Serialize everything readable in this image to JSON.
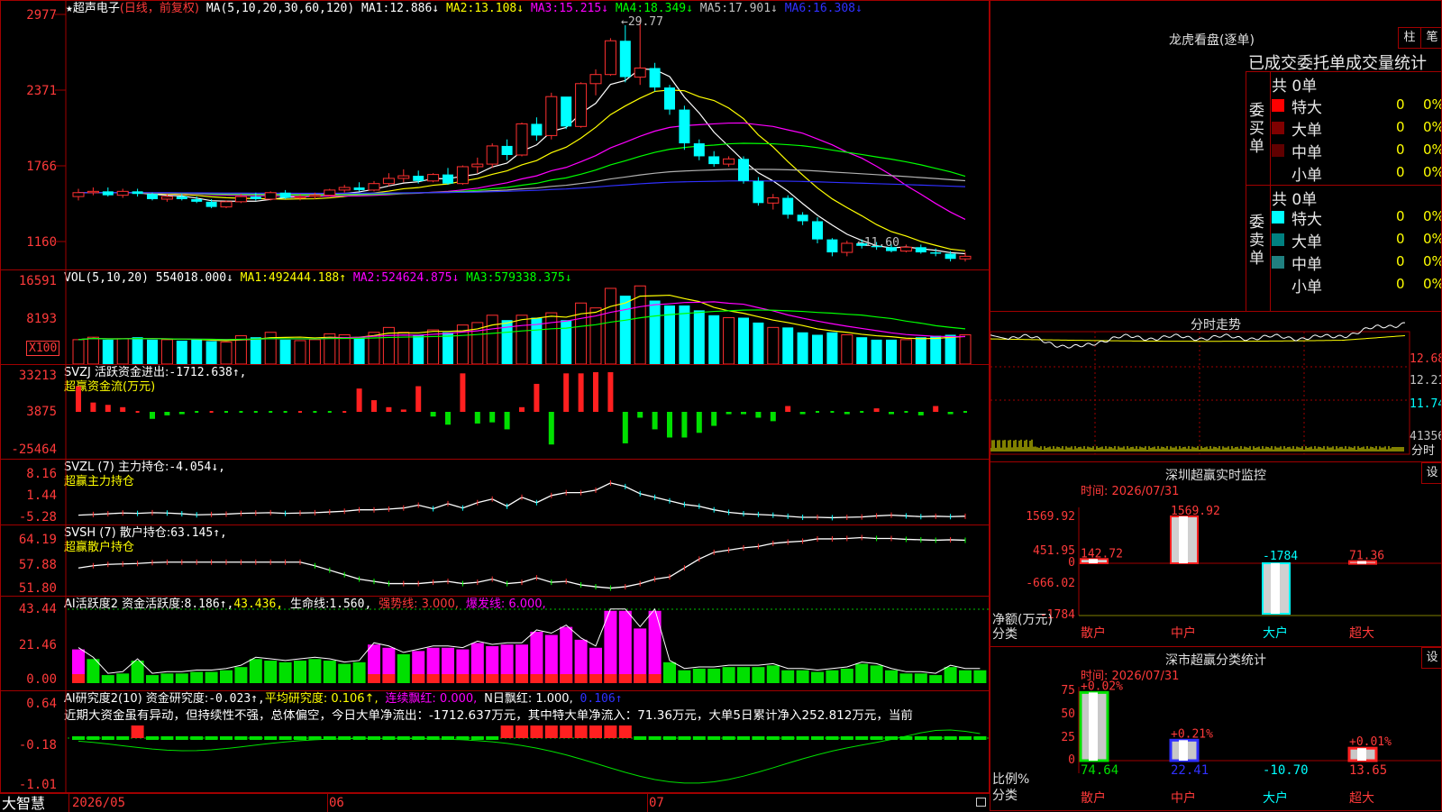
{
  "main": {
    "star": "★",
    "stock_name": "超声电子",
    "mode": "(日线，前复权)",
    "ma_label": "MA(5,10,20,30,60,120)",
    "ma_values": [
      {
        "label": "MA1:",
        "value": "12.886↓",
        "color": "#ffffff"
      },
      {
        "label": "MA2:",
        "value": "13.108↓",
        "color": "#ffff00"
      },
      {
        "label": "MA3:",
        "value": "15.215↓",
        "color": "#ff00ff"
      },
      {
        "label": "MA4:",
        "value": "18.349↓",
        "color": "#00ff00"
      },
      {
        "label": "MA5:",
        "value": "17.901↓",
        "color": "#c0c0c0"
      },
      {
        "label": "MA6:",
        "value": "16.308↓",
        "color": "#3030ff"
      }
    ],
    "y_labels": [
      "2977",
      "2371",
      "1766",
      "1160"
    ],
    "high_label": "←29.77",
    "low_label": "←11.60",
    "candles": [
      [
        16.2,
        16.8,
        15.9,
        16.5
      ],
      [
        16.5,
        16.9,
        16.3,
        16.6
      ],
      [
        16.6,
        16.9,
        16.2,
        16.3
      ],
      [
        16.3,
        16.8,
        16.1,
        16.6
      ],
      [
        16.6,
        16.8,
        16.2,
        16.4
      ],
      [
        16.4,
        16.5,
        15.9,
        16.0
      ],
      [
        16.0,
        16.4,
        15.8,
        16.2
      ],
      [
        16.2,
        16.4,
        15.9,
        16.0
      ],
      [
        16.0,
        16.2,
        15.7,
        15.8
      ],
      [
        15.8,
        16.0,
        15.3,
        15.4
      ],
      [
        15.4,
        15.9,
        15.3,
        15.8
      ],
      [
        15.8,
        16.4,
        15.7,
        16.2
      ],
      [
        16.2,
        16.5,
        15.9,
        16.0
      ],
      [
        16.0,
        16.6,
        15.9,
        16.5
      ],
      [
        16.5,
        16.7,
        16.0,
        16.1
      ],
      [
        16.1,
        16.4,
        15.9,
        16.2
      ],
      [
        16.2,
        16.5,
        16.0,
        16.3
      ],
      [
        16.3,
        16.8,
        16.2,
        16.7
      ],
      [
        16.7,
        17.1,
        16.5,
        16.9
      ],
      [
        16.9,
        17.3,
        16.6,
        16.7
      ],
      [
        16.7,
        17.4,
        16.6,
        17.2
      ],
      [
        17.2,
        18.0,
        17.0,
        17.6
      ],
      [
        17.6,
        18.3,
        17.3,
        17.8
      ],
      [
        17.8,
        18.2,
        17.2,
        17.4
      ],
      [
        17.4,
        18.0,
        17.3,
        17.9
      ],
      [
        17.9,
        18.4,
        17.1,
        17.2
      ],
      [
        17.2,
        18.6,
        17.1,
        18.5
      ],
      [
        18.5,
        19.2,
        18.0,
        18.7
      ],
      [
        18.7,
        20.3,
        18.4,
        20.1
      ],
      [
        20.1,
        20.6,
        19.0,
        19.4
      ],
      [
        19.4,
        21.9,
        19.3,
        21.8
      ],
      [
        21.8,
        22.3,
        20.5,
        20.9
      ],
      [
        20.9,
        24.2,
        20.6,
        23.9
      ],
      [
        23.9,
        22.7,
        21.4,
        21.6
      ],
      [
        21.6,
        25.0,
        21.5,
        24.9
      ],
      [
        24.9,
        26.0,
        24.0,
        25.6
      ],
      [
        25.6,
        28.4,
        25.5,
        28.2
      ],
      [
        28.2,
        29.4,
        25.0,
        25.4
      ],
      [
        25.4,
        29.77,
        24.8,
        26.1
      ],
      [
        26.1,
        26.5,
        24.3,
        24.6
      ],
      [
        24.6,
        24.8,
        22.5,
        22.9
      ],
      [
        22.9,
        23.2,
        19.8,
        20.3
      ],
      [
        20.3,
        20.6,
        19.0,
        19.3
      ],
      [
        19.3,
        19.7,
        18.5,
        18.7
      ],
      [
        18.7,
        19.3,
        18.5,
        19.1
      ],
      [
        19.1,
        19.3,
        17.2,
        17.4
      ],
      [
        17.4,
        17.7,
        15.5,
        15.7
      ],
      [
        15.7,
        16.4,
        15.2,
        16.1
      ],
      [
        16.1,
        16.3,
        14.5,
        14.8
      ],
      [
        14.8,
        15.0,
        14.0,
        14.3
      ],
      [
        14.3,
        14.6,
        12.6,
        12.9
      ],
      [
        12.9,
        13.0,
        11.6,
        11.9
      ],
      [
        11.9,
        12.8,
        11.6,
        12.6
      ],
      [
        12.6,
        12.9,
        12.2,
        12.4
      ],
      [
        12.4,
        12.7,
        12.1,
        12.3
      ],
      [
        12.3,
        12.5,
        11.9,
        12.0
      ],
      [
        12.0,
        12.5,
        11.9,
        12.3
      ],
      [
        12.3,
        12.5,
        11.8,
        11.9
      ],
      [
        11.9,
        12.2,
        11.6,
        11.8
      ],
      [
        11.8,
        12.0,
        11.2,
        11.4
      ],
      [
        11.4,
        11.9,
        11.2,
        11.6
      ]
    ]
  },
  "vol": {
    "label": "VOL(5,10,20)",
    "value": "554018.000↓",
    "ma": [
      {
        "label": "MA1:",
        "value": "492444.188↑",
        "color": "#ffff00"
      },
      {
        "label": "MA2:",
        "value": "524624.875↓",
        "color": "#ff00ff"
      },
      {
        "label": "MA3:",
        "value": "579338.375↓",
        "color": "#00ff00"
      }
    ],
    "y_labels": [
      "16591",
      "8193"
    ],
    "unit": "X100",
    "values": [
      5,
      5.5,
      5,
      5.2,
      5.5,
      5,
      5,
      4.8,
      5,
      4.7,
      4.5,
      5.8,
      5.5,
      6.5,
      5,
      4.8,
      5,
      6.2,
      6,
      5.5,
      6.5,
      7.5,
      6.5,
      6,
      7,
      6.5,
      8,
      8.5,
      10,
      9,
      10,
      9.5,
      10.5,
      9,
      12.5,
      11.5,
      15.5,
      14,
      16,
      13,
      12,
      12,
      11,
      10,
      9.5,
      9.5,
      8.5,
      7.5,
      7.5,
      6.5,
      6,
      6.5,
      6,
      5.5,
      5,
      5,
      5,
      5.5,
      5.8,
      6,
      6
    ]
  },
  "svzj": {
    "label": "SVZJ  活跃资金进出:",
    "value": "-1712.638↑,",
    "sub": "超赢资金流(万元)",
    "y_labels": [
      "33213",
      "3875",
      "-25464"
    ],
    "values": [
      22000,
      8000,
      6000,
      4000,
      1000,
      -6000,
      -3000,
      -2000,
      -1000,
      1000,
      -1000,
      -1000,
      -1000,
      -1000,
      -1000,
      0,
      -1000,
      -1000,
      0,
      20000,
      10000,
      4000,
      2000,
      22000,
      -4000,
      -11000,
      33000,
      -10000,
      -9000,
      -15000,
      4000,
      24000,
      -28000,
      33000,
      33000,
      34000,
      34000,
      -27000,
      -5000,
      -15000,
      -22000,
      -22000,
      -18000,
      -12000,
      -2000,
      -2000,
      -5000,
      -8000,
      5000,
      -2000,
      -1000,
      -1000,
      -2000,
      -1000,
      3000,
      -2000,
      -1000,
      -3000,
      5000,
      -2000,
      -1000
    ]
  },
  "svzl": {
    "label": "SVZL (7) 主力持仓:",
    "value": "-4.054↓,",
    "sub": "超赢主力持仓",
    "y_labels": [
      "8.16",
      "1.44",
      "-5.28"
    ],
    "values": [
      -4.0,
      -3.8,
      -3.6,
      -3.4,
      -3.5,
      -3.3,
      -3.4,
      -3.6,
      -3.9,
      -3.8,
      -3.7,
      -3.5,
      -3.4,
      -3.3,
      -3.5,
      -3.4,
      -3.3,
      -3.1,
      -2.9,
      -2.5,
      -2.5,
      -2.3,
      -2.0,
      -1.2,
      -2.2,
      -0.8,
      -2.0,
      -0.5,
      0.5,
      -1.5,
      1.0,
      -0.5,
      1.5,
      2.3,
      2.3,
      3.0,
      5.0,
      4.0,
      2.0,
      1.0,
      0.0,
      -1.0,
      -1.5,
      -2.5,
      -3.2,
      -3.6,
      -3.8,
      -4.0,
      -4.3,
      -4.6,
      -4.6,
      -4.7,
      -4.6,
      -4.5,
      -4.2,
      -4.0,
      -4.2,
      -4.4,
      -4.3,
      -4.4,
      -4.3
    ]
  },
  "svsh": {
    "label": "SVSH (7) 散户持仓:",
    "value": "63.145↑,",
    "sub": "超赢散户持仓",
    "y_labels": [
      "64.19",
      "57.88",
      "51.80"
    ],
    "values": [
      57.0,
      57.5,
      57.8,
      57.9,
      58.0,
      58.2,
      58.3,
      58.3,
      58.3,
      58.3,
      58.3,
      58.3,
      58.3,
      58.3,
      58.3,
      58.3,
      57.5,
      56.5,
      55.5,
      54.5,
      54.0,
      53.5,
      53.5,
      53.5,
      53.8,
      54.0,
      53.5,
      53.8,
      54.5,
      53.5,
      53.8,
      54.8,
      53.8,
      54.0,
      53.2,
      52.8,
      52.5,
      52.8,
      53.5,
      54.5,
      55.0,
      57.0,
      59.0,
      60.5,
      61.0,
      61.5,
      61.8,
      62.5,
      62.8,
      63.0,
      63.5,
      63.5,
      63.6,
      63.8,
      63.6,
      63.6,
      63.4,
      63.3,
      63.2,
      63.3,
      63.2
    ]
  },
  "ai1": {
    "label": "AI活跃度2 资金活跃度:",
    "value": "8.186↑,",
    "v2": "43.436,",
    "life_label": "生命线:",
    "life": "1.560,",
    "strong": "强势线: 3.000,",
    "burst": "爆发线: 6.000,",
    "y_labels": [
      "43.44",
      "21.46",
      "0.00"
    ],
    "values": [
      21,
      15,
      5,
      6,
      14,
      5,
      6,
      6,
      7,
      7,
      8,
      10,
      15,
      14,
      13,
      14,
      15,
      14,
      12,
      13,
      24,
      22,
      18,
      20,
      22,
      22,
      21,
      25,
      23,
      24,
      24,
      32,
      30,
      35,
      27,
      22,
      45,
      45,
      34,
      45,
      13,
      8,
      9,
      9,
      10,
      10,
      10,
      11,
      8,
      8,
      7,
      8,
      9,
      12,
      11,
      8,
      6,
      6,
      5,
      10,
      8,
      8
    ],
    "strong_color": "#ff00ff"
  },
  "ai2": {
    "label": "AI研究度2(10) 资金研究度:",
    "value": "-0.023↑,",
    "avg": "平均研究度: 0.106↑,",
    "red": "连续飘红: 0.000,",
    "n": "N日飘红: 1.000,",
    "nv": "0.106↑",
    "y_labels": [
      "0.64",
      "-0.18",
      "-1.01"
    ],
    "comment": "近期大资金虽有异动，但持续性不强，总体偏空，今日大单净流出：-1712.637万元，其中特大单净流入：71.36万元，大单5日累计净入252.812万元，当前"
  },
  "xaxis": {
    "brand": "大智慧",
    "labels": [
      "2026/05",
      "06",
      "07"
    ]
  },
  "right": {
    "lhb": {
      "title": "龙虎看盘(逐单)",
      "btn1": "柱",
      "btn2": "笔",
      "subtitle": "已成交委托单成交量统计",
      "buy_total": "共 0单",
      "buy_side": "委买单",
      "sell_total": "共 0单",
      "sell_side": "委卖单",
      "rows_buy": [
        {
          "color": "#ff0000",
          "name": "特大",
          "v": "0",
          "p": "0%"
        },
        {
          "color": "#800000",
          "name": "大单",
          "v": "0",
          "p": "0%"
        },
        {
          "color": "#600000",
          "name": "中单",
          "v": "0",
          "p": "0%"
        },
        {
          "color": "",
          "name": "小单",
          "v": "0",
          "p": "0%"
        }
      ],
      "rows_sell": [
        {
          "color": "#00ffff",
          "name": "特大",
          "v": "0",
          "p": "0%"
        },
        {
          "color": "#008080",
          "name": "大单",
          "v": "0",
          "p": "0%"
        },
        {
          "color": "#208080",
          "name": "中单",
          "v": "0",
          "p": "0%"
        },
        {
          "color": "",
          "name": "小单",
          "v": "0",
          "p": "0%"
        }
      ]
    },
    "intraday": {
      "title": "分时走势",
      "labels": [
        "12.68",
        "12.21",
        "11.74",
        "41356"
      ],
      "unit": "分时"
    },
    "sz": {
      "title": "深圳超赢实时监控",
      "btn": "设",
      "time": "时间: 2026/07/31",
      "y_labels": [
        "1569.92",
        "451.95",
        "0",
        "-666.02",
        "-1784"
      ],
      "net": "净额(万元)",
      "cat": "分类",
      "bars": [
        {
          "name": "散户",
          "value": 142.72,
          "label": "142.72"
        },
        {
          "name": "中户",
          "value": 1569.92,
          "label": "1569.92"
        },
        {
          "name": "大户",
          "value": -1784,
          "label": "-1784"
        },
        {
          "name": "超大",
          "value": 71.36,
          "label": "71.36"
        }
      ]
    },
    "cls": {
      "title": "深市超赢分类统计",
      "btn": "设",
      "time": "时间: 2026/07/31",
      "y_labels": [
        "75",
        "50",
        "25",
        "0"
      ],
      "ratio": "比例%",
      "cat": "分类",
      "bars": [
        {
          "name": "散户",
          "value": 74.64,
          "top": "+0.02%",
          "label": "74.64"
        },
        {
          "name": "中户",
          "value": 22.41,
          "top": "+0.21%",
          "label": "22.41"
        },
        {
          "name": "大户",
          "value": -10.7,
          "top": "",
          "label": "-10.70"
        },
        {
          "name": "超大",
          "value": 13.65,
          "top": "+0.01%",
          "label": "13.65"
        }
      ]
    }
  }
}
